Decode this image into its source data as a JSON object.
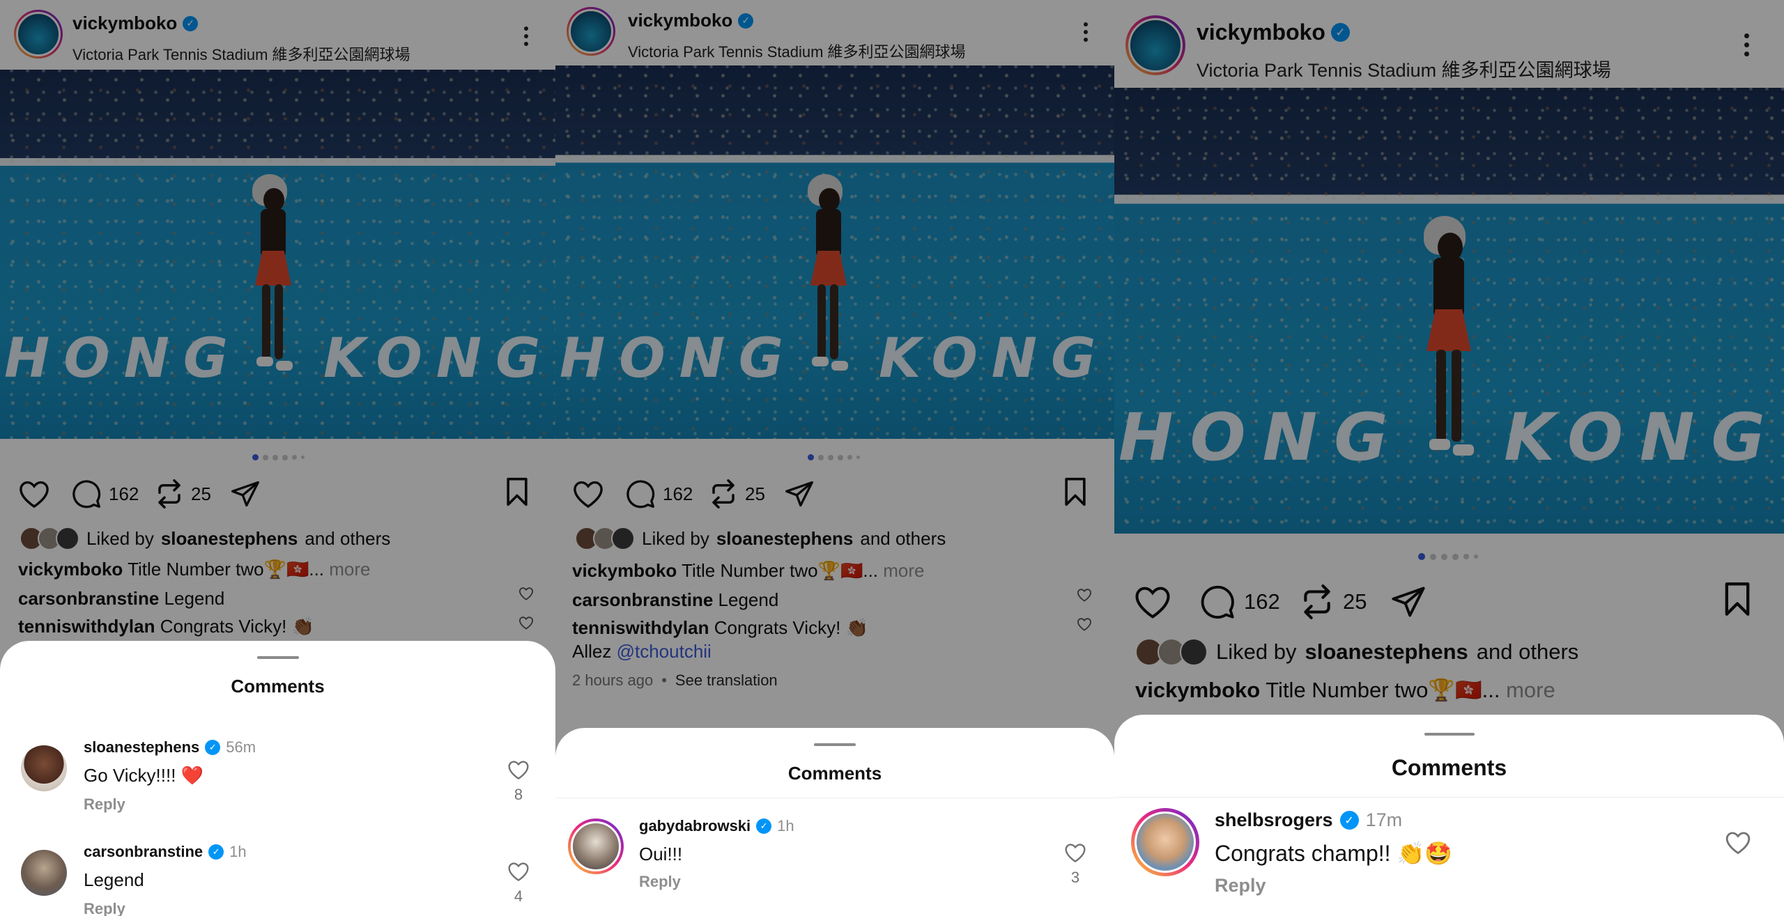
{
  "post": {
    "username": "vickymboko",
    "location": "Victoria Park Tennis Stadium 維多利亞公園網球場",
    "court_text": "HONG KONG",
    "comment_count": "162",
    "repost_count": "25",
    "liked_by_prefix": "Liked by",
    "liked_by_user": "sloanestephens",
    "liked_by_suffix": "and others",
    "caption_user": "vickymboko",
    "caption_text": "Title Number two🏆🇭🇰...",
    "caption_more": "more",
    "preview_comments": [
      {
        "user": "carsonbranstine",
        "text": "Legend"
      },
      {
        "user": "tenniswithdylan",
        "text": "Congrats Vicky! 👏🏾",
        "extra_prefix": "Allez",
        "extra_mention": "@tchoutchii"
      }
    ],
    "timestamp": "2 hours ago",
    "see_translation": "See translation",
    "meta_sep": "•"
  },
  "sheet": {
    "title": "Comments",
    "reply_label": "Reply"
  },
  "panel1_comments": [
    {
      "user": "sloanestephens",
      "time": "56m",
      "text": "Go Vicky!!!! ❤️",
      "likes": "8"
    },
    {
      "user": "carsonbranstine",
      "time": "1h",
      "text": "Legend",
      "likes": "4"
    }
  ],
  "panel2_comments": [
    {
      "user": "gabydabrowski",
      "time": "1h",
      "text": "Oui!!!",
      "likes": "3"
    }
  ],
  "panel3_comments": [
    {
      "user": "shelbsrogers",
      "time": "17m",
      "text": "Congrats champ!! 👏🤩",
      "likes": ""
    }
  ],
  "icons": {
    "verified": "✓",
    "like": "heart-icon",
    "comment": "comment-icon",
    "repost": "repost-icon",
    "share": "send-icon",
    "save": "bookmark-icon",
    "menu": "more-options-icon"
  },
  "colors": {
    "accent_blue": "#0095f6",
    "mention_blue": "#3b5bdb",
    "court_blue": "#1b97c8",
    "muted": "#8e8e8e"
  }
}
